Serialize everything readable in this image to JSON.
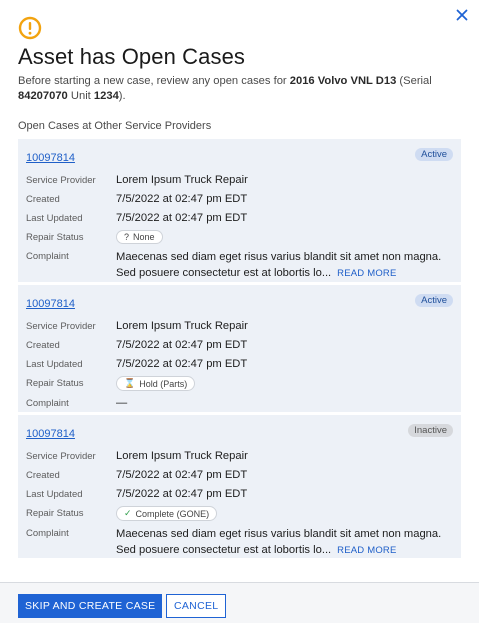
{
  "dialog": {
    "title": "Asset has Open Cases",
    "intro_prefix": "Before starting a new case, review any open cases for ",
    "asset_name": "2016 Volvo VNL D13",
    "serial_prefix": " (Serial ",
    "serial_number": "84207070",
    "unit_prefix": " Unit ",
    "unit_number": "1234",
    "intro_suffix": ").",
    "section_label": "Open Cases at Other Service Providers",
    "accent_color": "#1f63d4",
    "warning_color": "#f2a30f",
    "icons": {
      "warning": "warning-circle-icon",
      "close": "close-icon"
    }
  },
  "labels": {
    "service_provider": "Service Provider",
    "created": "Created",
    "last_updated": "Last Updated",
    "repair_status": "Repair Status",
    "complaint": "Complaint",
    "read_more": "READ MORE"
  },
  "cases": [
    {
      "id": "10097814",
      "status": "Active",
      "service_provider": "Lorem Ipsum Truck Repair",
      "created": "7/5/2022 at 02:47 pm EDT",
      "last_updated": "7/5/2022 at 02:47 pm EDT",
      "repair_status": "None",
      "repair_status_icon": "question-icon",
      "repair_status_glyph": "?",
      "complaint": "Maecenas sed diam eget risus varius blandit sit amet non magna. Sed posuere consectetur est at lobortis lo..."
    },
    {
      "id": "10097814",
      "status": "Active",
      "service_provider": "Lorem Ipsum Truck Repair",
      "created": "7/5/2022 at 02:47 pm EDT",
      "last_updated": "7/5/2022 at 02:47 pm EDT",
      "repair_status": "Hold (Parts)",
      "repair_status_icon": "hourglass-icon",
      "repair_status_glyph": "⌛",
      "complaint": "—"
    },
    {
      "id": "10097814",
      "status": "Inactive",
      "service_provider": "Lorem Ipsum Truck Repair",
      "created": "7/5/2022 at 02:47 pm EDT",
      "last_updated": "7/5/2022 at 02:47 pm EDT",
      "repair_status": "Complete (GONE)",
      "repair_status_icon": "checkmark-icon",
      "repair_status_glyph": "✓",
      "complaint": "Maecenas sed diam eget risus varius blandit sit amet non magna. Sed posuere consectetur est at lobortis lo..."
    }
  ],
  "footer": {
    "primary_label": "SKIP AND CREATE CASE",
    "secondary_label": "CANCEL"
  }
}
